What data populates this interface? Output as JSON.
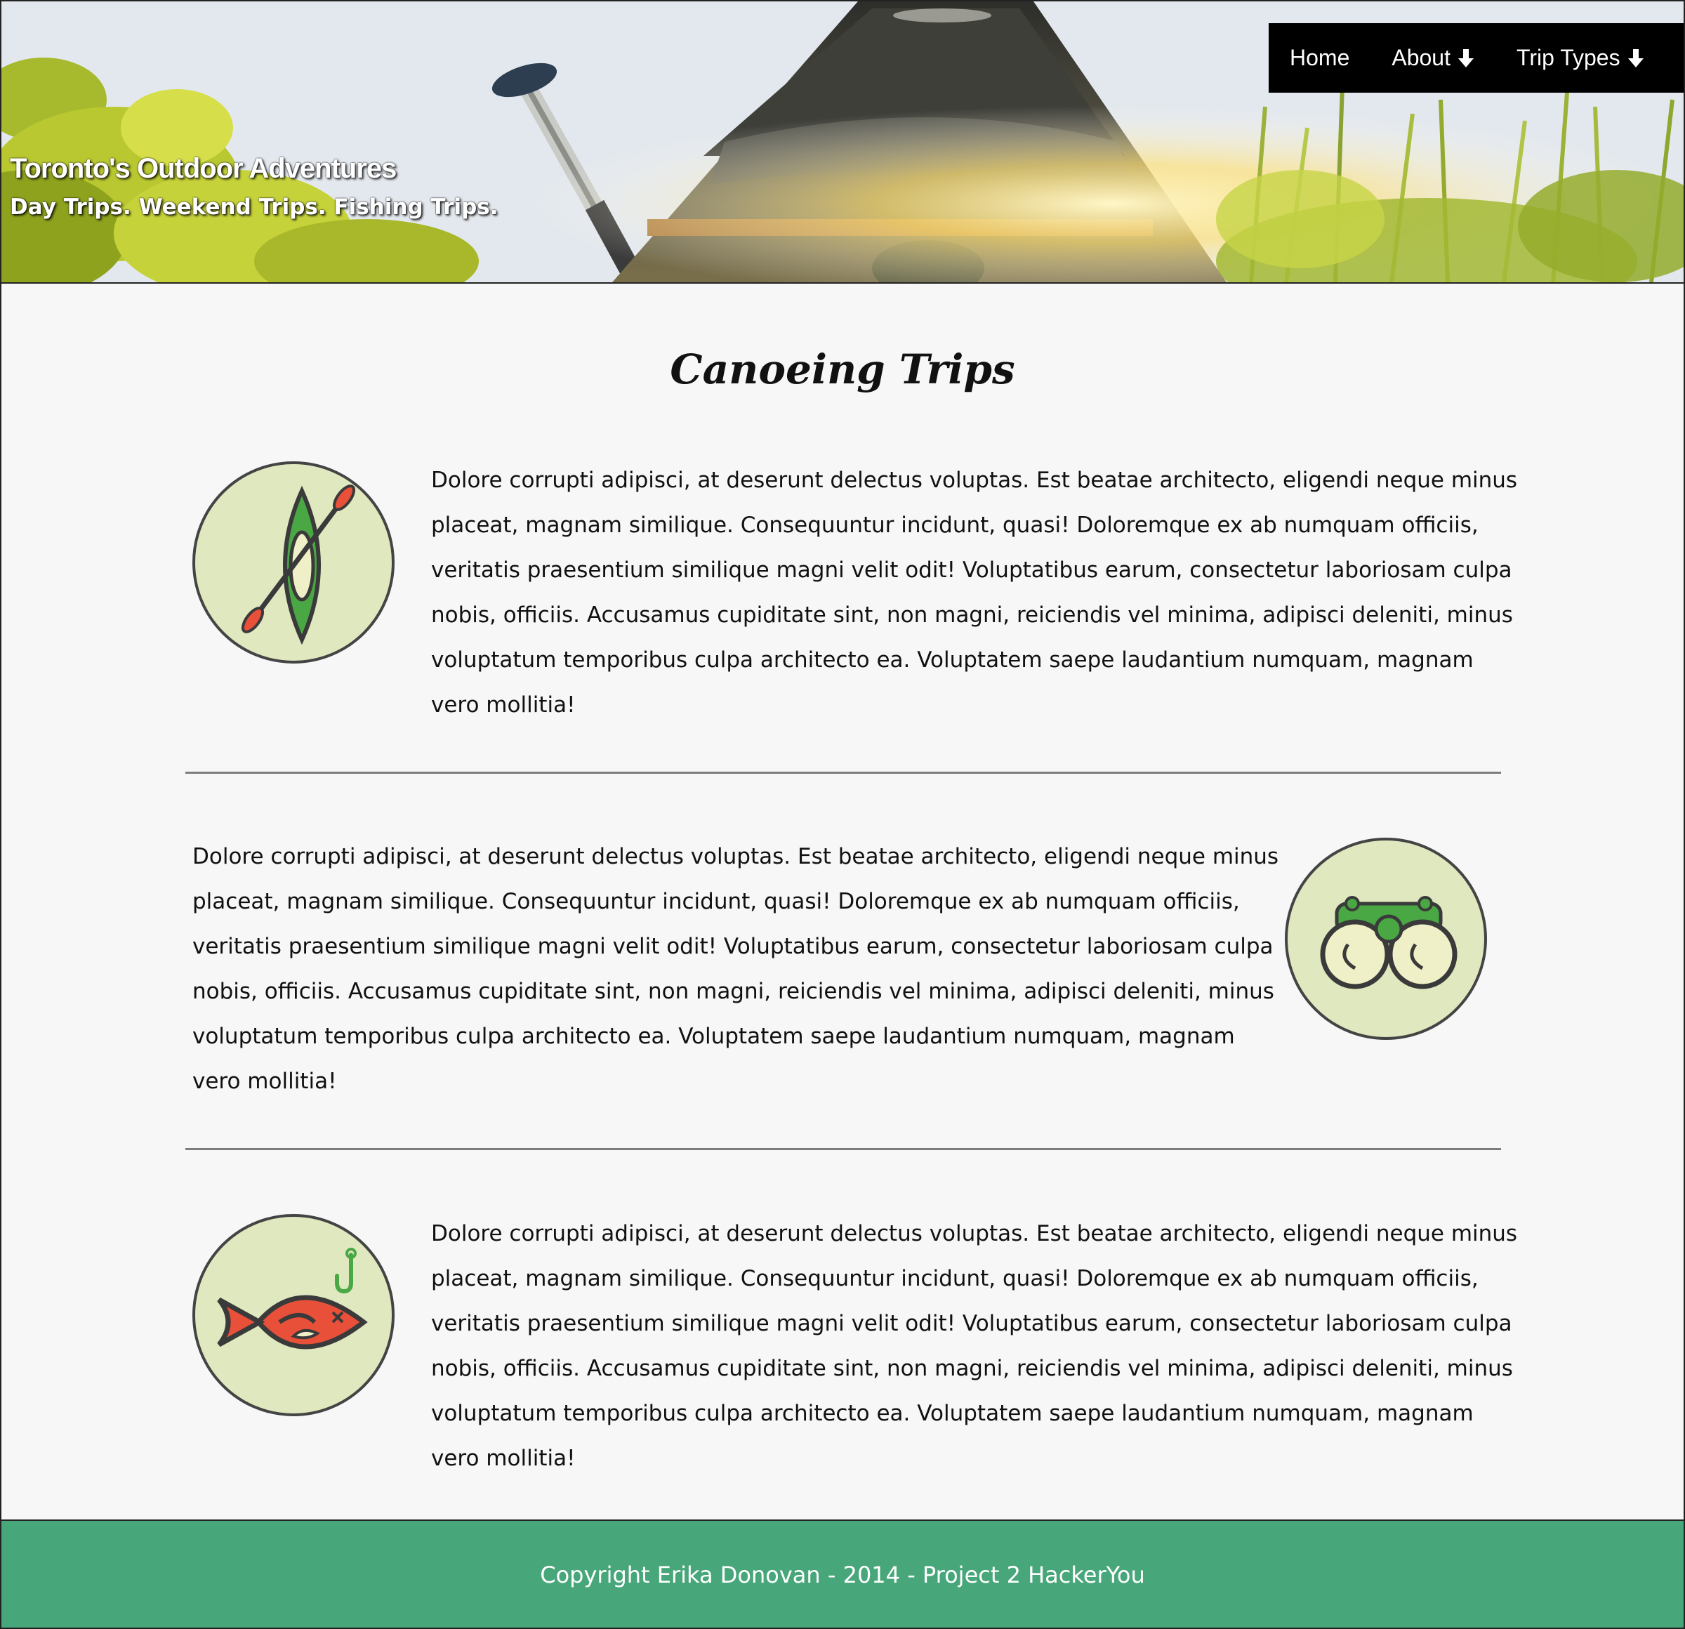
{
  "header": {
    "site_title": "Toronto's Outdoor Adventures",
    "tagline": "Day Trips. Weekend Trips. Fishing Trips."
  },
  "nav": {
    "items": [
      {
        "label": "Home",
        "icon": null
      },
      {
        "label": "About",
        "icon": "arrow-down-icon"
      },
      {
        "label": "Trip Types",
        "icon": "arrow-down-icon"
      }
    ]
  },
  "main": {
    "title": "Canoeing Trips",
    "trips": [
      {
        "icon": "kayak-icon",
        "lines": [
          "Dolore corrupti adipisci, at deserunt delectus voluptas. Est beatae architecto, eligendi neque minus",
          "placeat, magnam similique. Consequuntur incidunt, quasi! Doloremque ex ab numquam officiis,",
          "veritatis praesentium similique magni velit odit! Voluptatibus earum, consectetur laboriosam culpa",
          "nobis, officiis. Accusamus cupiditate sint, non magni, reiciendis vel minima, adipisci deleniti, minus",
          "voluptatum temporibus culpa architecto ea. Voluptatem saepe laudantium numquam, magnam",
          "vero mollitia!"
        ]
      },
      {
        "icon": "binoculars-icon",
        "lines": [
          "Dolore corrupti adipisci, at deserunt delectus voluptas. Est beatae architecto, eligendi neque minus",
          "placeat, magnam similique. Consequuntur incidunt, quasi! Doloremque ex ab numquam officiis,",
          "veritatis praesentium similique magni velit odit! Voluptatibus earum, consectetur laboriosam culpa",
          "nobis, officiis. Accusamus cupiditate sint, non magni, reiciendis vel minima, adipisci deleniti, minus",
          "voluptatum temporibus culpa architecto ea. Voluptatem saepe laudantium numquam, magnam",
          "vero mollitia!"
        ]
      },
      {
        "icon": "fish-hook-icon",
        "lines": [
          "Dolore corrupti adipisci, at deserunt delectus voluptas. Est beatae architecto, eligendi neque minus",
          "placeat, magnam similique. Consequuntur incidunt, quasi! Doloremque ex ab numquam officiis,",
          "veritatis praesentium similique magni velit odit! Voluptatibus earum, consectetur laboriosam culpa",
          "nobis, officiis. Accusamus cupiditate sint, non magni, reiciendis vel minima, adipisci deleniti, minus",
          "voluptatum temporibus culpa architecto ea. Voluptatem saepe laudantium numquam, magnam",
          "vero mollitia!"
        ]
      }
    ]
  },
  "footer": {
    "copyright": "Copyright Erika Donovan - 2014 - Project 2 HackerYou"
  },
  "colors": {
    "footer_bg": "#48a77a",
    "badge_bg": "#dfe8bf",
    "nav_bg": "#000000",
    "icon_green": "#4aa844",
    "icon_red": "#e8503a"
  }
}
